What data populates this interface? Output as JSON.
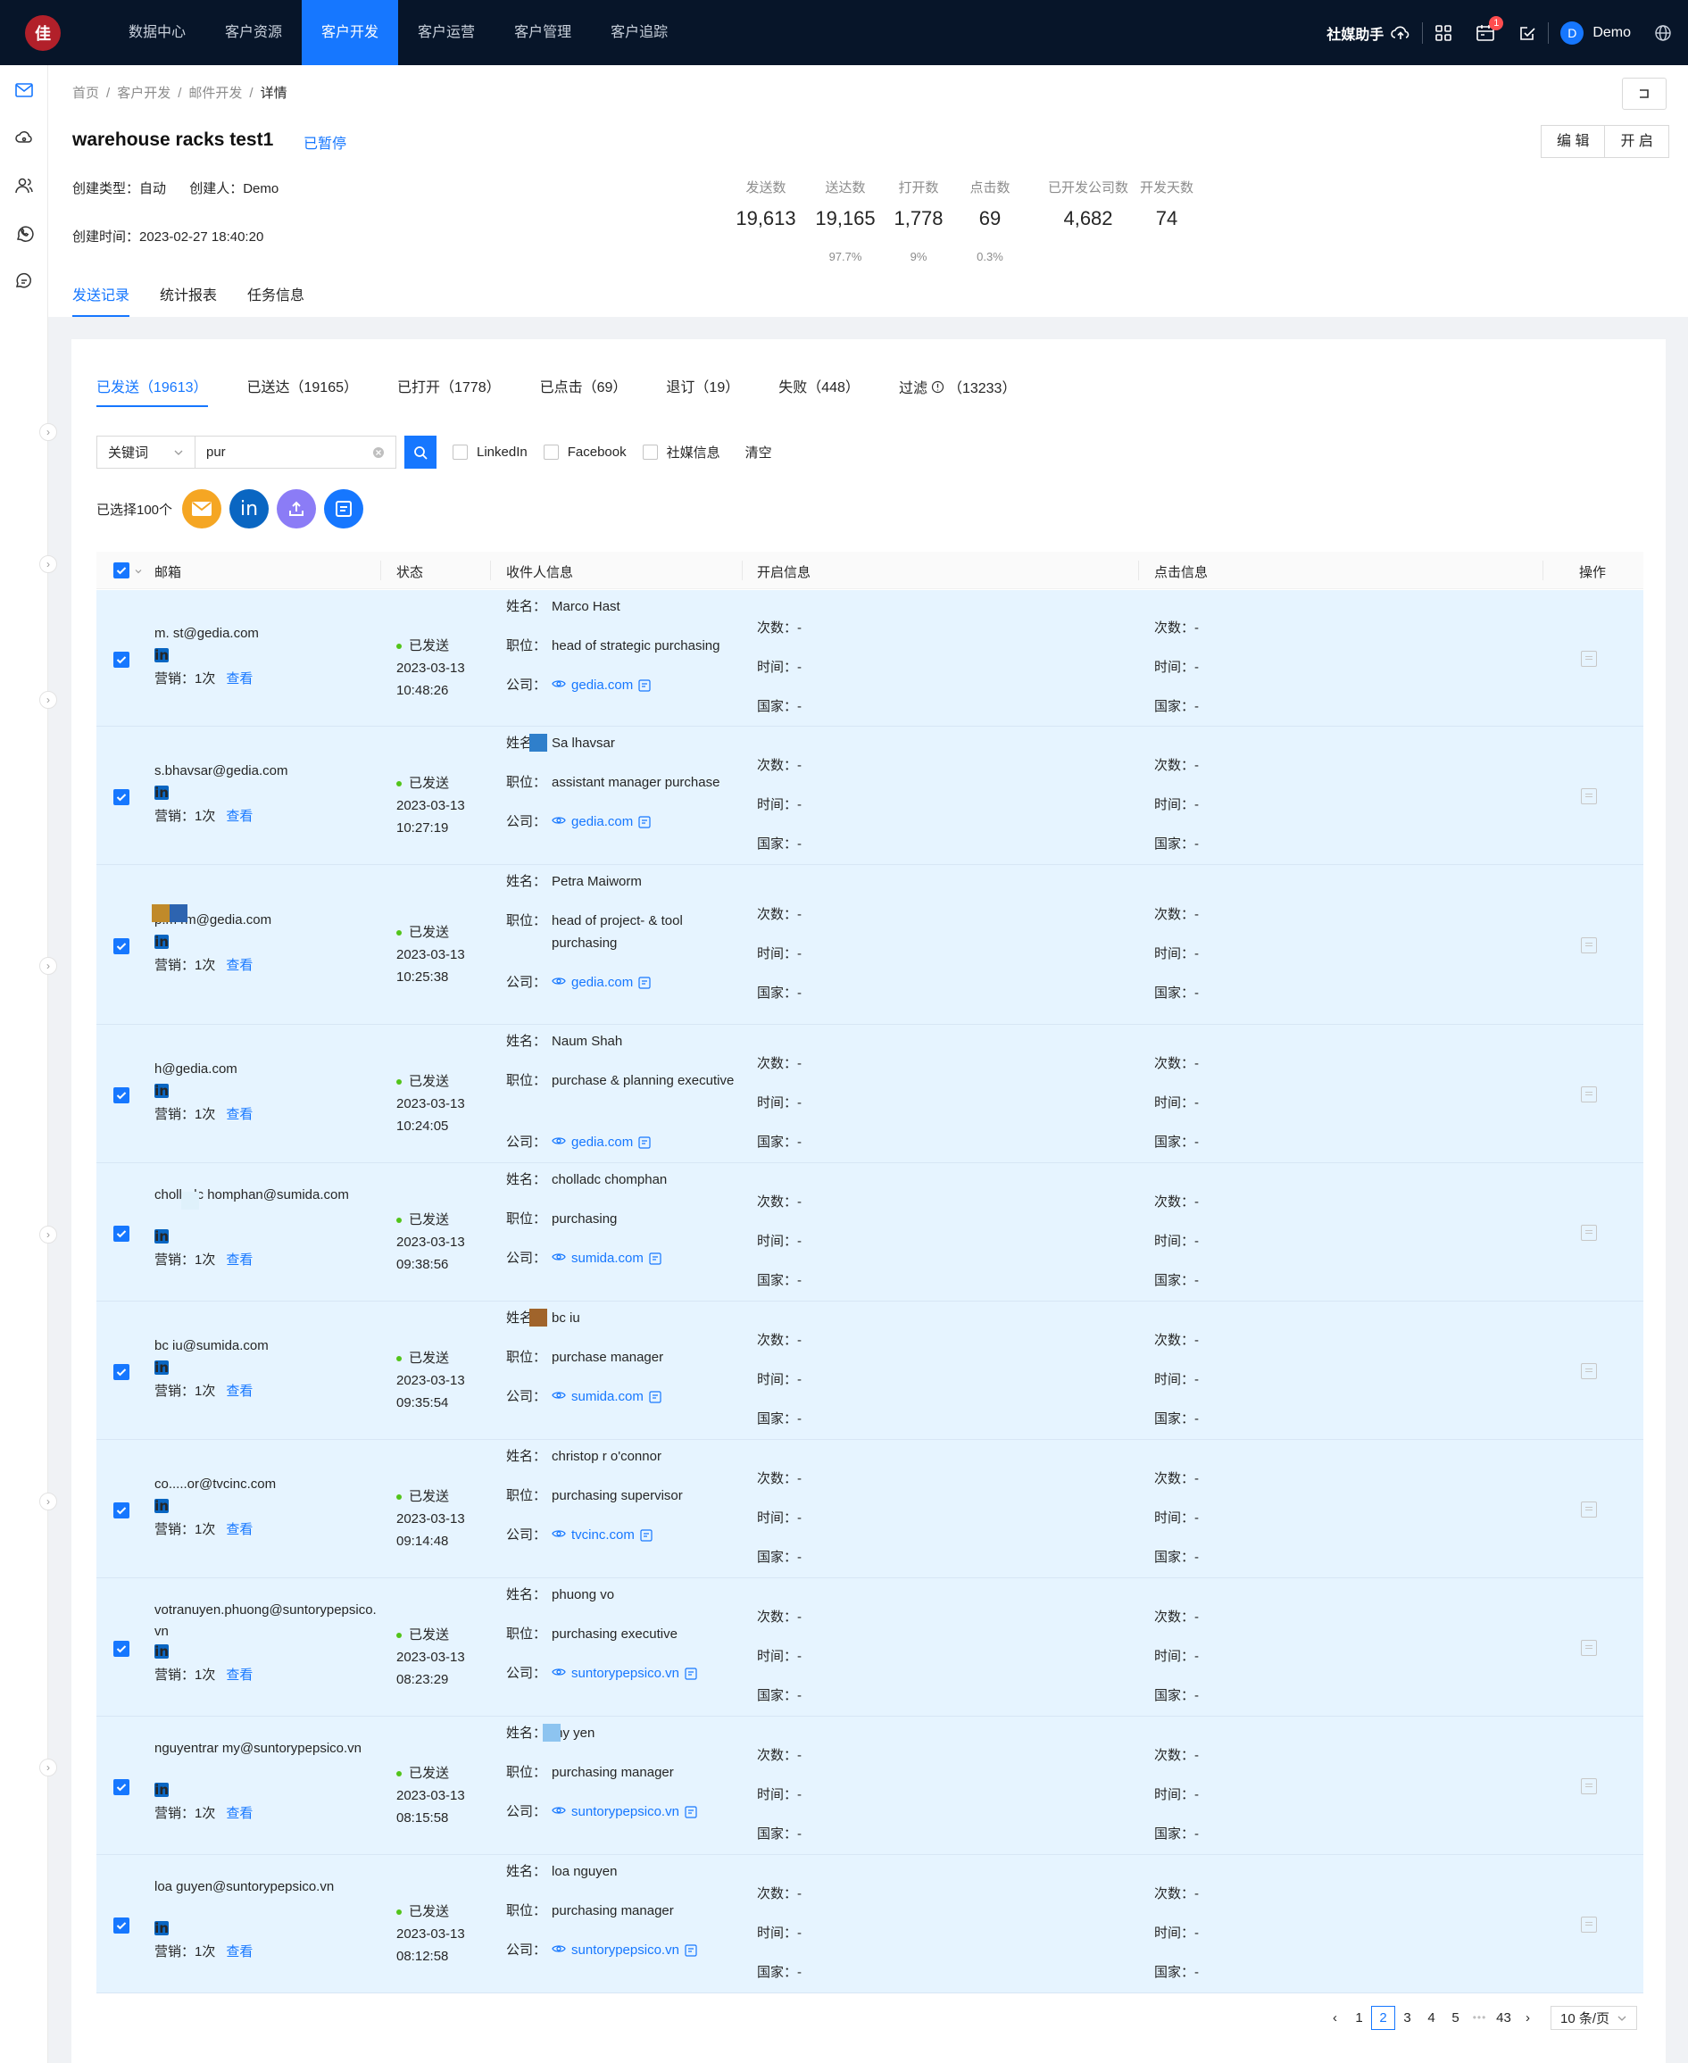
{
  "topbar": {
    "logo_text": "佳",
    "nav": [
      "数据中心",
      "客户资源",
      "客户开发",
      "客户运营",
      "客户管理",
      "客户追踪"
    ],
    "active_nav": 2,
    "assistant": "社媒助手",
    "badge": "1",
    "user": {
      "initial": "D",
      "name": "Demo"
    }
  },
  "breadcrumb": [
    "首页",
    "/",
    "客户开发",
    "/",
    "邮件开发",
    "/",
    "详情"
  ],
  "header": {
    "title": "warehouse racks test1",
    "status": "已暂停",
    "edit": "编 辑",
    "start": "开 启",
    "create_type": "创建类型：自动",
    "creator": "创建人：Demo",
    "create_time": "创建时间：2023-02-27 18:40:20",
    "collapse_icon": "collapse-icon"
  },
  "stats": [
    {
      "label": "发送数",
      "value": "19,613",
      "pct": ""
    },
    {
      "label": "送达数",
      "value": "19,165",
      "pct": "97.7%"
    },
    {
      "label": "打开数",
      "value": "1,778",
      "pct": "9%"
    },
    {
      "label": "点击数",
      "value": "69",
      "pct": "0.3%"
    },
    {
      "label": "已开发公司数",
      "value": "4,682",
      "pct": ""
    },
    {
      "label": "开发天数",
      "value": "74",
      "pct": ""
    }
  ],
  "tabs": [
    "发送记录",
    "统计报表",
    "任务信息"
  ],
  "subtabs": [
    "已发送（19613）",
    "已送达（19165）",
    "已打开（1778）",
    "已点击（69）",
    "退订（19）",
    "失败（448）",
    "过滤",
    "（13233）"
  ],
  "filter": {
    "select": "关键词",
    "input": "pur",
    "checks": [
      "LinkedIn",
      "Facebook",
      "社媒信息"
    ],
    "clear": "清空"
  },
  "selected": "已选择100个",
  "columns": [
    "邮箱",
    "状态",
    "收件人信息",
    "开启信息",
    "点击信息",
    "操作"
  ],
  "labels": {
    "marketing": "营销：",
    "times": "1次",
    "view": "查看",
    "name": "姓名：",
    "position": "职位：",
    "company": "公司：",
    "count": "次数：",
    "time": "时间：",
    "country": "国家：",
    "dash": "-",
    "sent": "已发送"
  },
  "rows": [
    {
      "email": "m.   st@gedia.com",
      "date": "2023-03-13",
      "time": "10:48:26",
      "name": "Marco Hast",
      "position": "head of strategic purchasing",
      "company": "gedia.com"
    },
    {
      "email": "s.bhavsar@gedia.com",
      "date": "2023-03-13",
      "time": "10:27:19",
      "name": "Sa     lhavsar",
      "position": "assistant manager purchase",
      "company": "gedia.com"
    },
    {
      "email": "p.m    rm@gedia.com",
      "date": "2023-03-13",
      "time": "10:25:38",
      "name": "Petra Maiworm",
      "position": "head of project- & tool purchasing",
      "company": "gedia.com"
    },
    {
      "email": "     h@gedia.com",
      "date": "2023-03-13",
      "time": "10:24:05",
      "name": "Naum Shah",
      "position": "purchase & planning executive",
      "company": "gedia.com"
    },
    {
      "email": "cholladc     homphan@sumida.com",
      "date": "2023-03-13",
      "time": "09:38:56",
      "name": "cholladc    chomphan",
      "position": "purchasing",
      "company": "sumida.com"
    },
    {
      "email": "bc     iu@sumida.com",
      "date": "2023-03-13",
      "time": "09:35:54",
      "name": "bc    iu",
      "position": "purchase manager",
      "company": "sumida.com"
    },
    {
      "email": "co.....or@tvcinc.com",
      "date": "2023-03-13",
      "time": "09:14:48",
      "name": "christop     r o'connor",
      "position": "purchasing supervisor",
      "company": "tvcinc.com"
    },
    {
      "email": "votranuyen.phuong@suntorypepsico.vn",
      "date": "2023-03-13",
      "time": "08:23:29",
      "name": "phuong vo",
      "position": "purchasing executive",
      "company": "suntorypepsico.vn"
    },
    {
      "email": "nguyentrar        my@suntorypepsico.vn",
      "date": "2023-03-13",
      "time": "08:15:58",
      "name": "my     yen",
      "position": "purchasing manager",
      "company": "suntorypepsico.vn"
    },
    {
      "email": "loa     guyen@suntorypepsico.vn",
      "date": "2023-03-13",
      "time": "08:12:58",
      "name": "loa    nguyen",
      "position": "purchasing manager",
      "company": "suntorypepsico.vn"
    }
  ],
  "pager": {
    "pages": [
      "1",
      "2",
      "3",
      "4",
      "5",
      "•••",
      "43"
    ],
    "active": "2",
    "size": "10 条/页"
  }
}
